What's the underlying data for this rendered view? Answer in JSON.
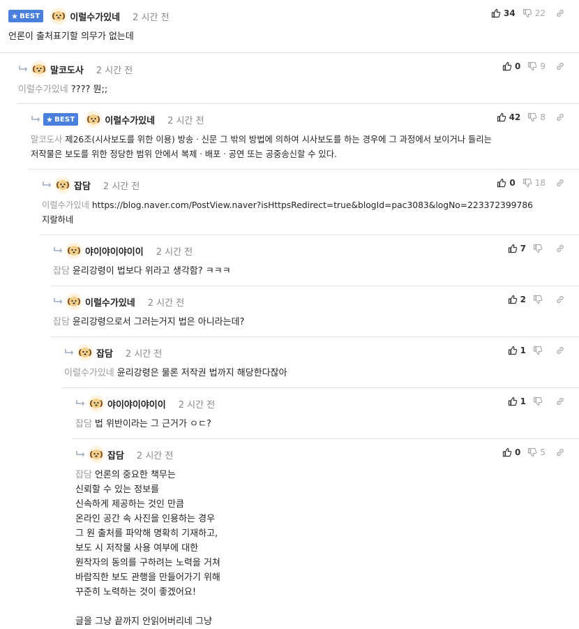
{
  "comments": [
    {
      "best": true,
      "best_label": "BEST",
      "author": "이럴수가있네",
      "time": "2 시간 전",
      "up": "34",
      "down": "22",
      "mention": "",
      "lines": [
        "언론이 출처표기할 의무가 없는데"
      ]
    },
    {
      "best": false,
      "author": "말코도사",
      "time": "2 시간 전",
      "up": "0",
      "down": "9",
      "mention": "이럴수가있네",
      "lines": [
        "???? 뭔;;"
      ]
    },
    {
      "best": true,
      "best_label": "BEST",
      "author": "이럴수가있네",
      "time": "2 시간 전",
      "up": "42",
      "down": "8",
      "mention": "말코도사",
      "lines": [
        "제26조(시사보도를 위한 이용) 방송ㆍ신문 그 밖의 방법에 의하여 시사보도를 하는 경우에 그 과정에서 보이거나 들리는",
        "저작물은 보도를 위한 정당한 범위 안에서 복제ㆍ배포ㆍ공연 또는 공중송신할 수 있다."
      ]
    },
    {
      "best": false,
      "author": "잡담",
      "time": "2 시간 전",
      "up": "0",
      "down": "18",
      "mention": "이럴수가있네",
      "lines": [
        "https://blog.naver.com/PostView.naver?isHttpsRedirect=true&blogId=pac3083&logNo=223372399786",
        "지랄하네"
      ]
    },
    {
      "best": false,
      "author": "야이야이야이이",
      "time": "2 시간 전",
      "up": "7",
      "down": "",
      "mention": "잡담",
      "lines": [
        "윤리강령이 법보다 위라고 생각함? ㅋㅋㅋ"
      ]
    },
    {
      "best": false,
      "author": "이럴수가있네",
      "time": "2 시간 전",
      "up": "2",
      "down": "",
      "mention": "잡담",
      "lines": [
        "윤리강령으로서 그러는거지 법은 아니라는데?"
      ]
    },
    {
      "best": false,
      "author": "잡담",
      "time": "2 시간 전",
      "up": "1",
      "down": "",
      "mention": "이럴수가있네",
      "lines": [
        "윤리강령은 물론 저작권 법까지 해당한다잖아"
      ]
    },
    {
      "best": false,
      "author": "야이야이야이이",
      "time": "2 시간 전",
      "up": "1",
      "down": "",
      "mention": "잡담",
      "lines": [
        "법 위반이라는 그 근거가 ㅇㄷ?"
      ]
    },
    {
      "best": false,
      "author": "잡담",
      "time": "2 시간 전",
      "up": "0",
      "down": "5",
      "mention": "잡담",
      "lines": [
        "언론의 중요한 책무는",
        "신뢰할 수 있는 정보를",
        "신속하게 제공하는 것인 만큼",
        "온라인 공간 속 사진을 인용하는 경우",
        "그 원 출처를 파악해 명확히 기재하고,",
        "보도 시 저작물 사용 여부에 대한",
        "원작자의 동의를 구하려는 노력을 거쳐",
        "바람직한 보도 관행을 만들어가기 위해",
        "꾸준히 노력하는 것이 좋겠어요!",
        "",
        "글을 그냥 끝까지 안읽어버리네 그냥"
      ]
    }
  ]
}
